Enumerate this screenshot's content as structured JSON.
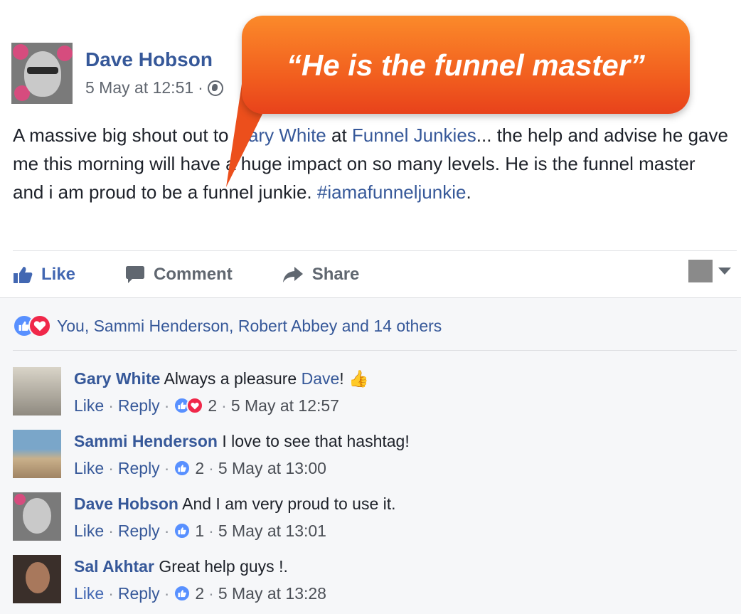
{
  "post": {
    "author": "Dave Hobson",
    "date": "5 May at 12:51",
    "separator": "·",
    "body_prefix": "A massive big shout out to ",
    "mention_person": "Gary White",
    "body_mid": " at ",
    "mention_page": "Funnel Junkies",
    "body_rest": "... the help and advise he gave me this morning will have a huge impact on so many levels. He is the funnel master and i am proud to be a funnel junkie. ",
    "hashtag": "#iamafunneljunkie",
    "body_end": "."
  },
  "actions": {
    "like": "Like",
    "comment": "Comment",
    "share": "Share"
  },
  "reactions_summary": "You, Sammi Henderson, Robert Abbey and 14 others",
  "callout": "“He is the funnel master”",
  "comments": [
    {
      "name": "Gary White",
      "text": "Always a pleasure ",
      "mention": "Dave",
      "text_end": "! 👍",
      "like": "Like",
      "reply": "Reply",
      "count": "2",
      "time": "5 May at 12:57"
    },
    {
      "name": "Sammi Henderson",
      "text": "I love to see that hashtag!",
      "mention": "",
      "text_end": "",
      "like": "Like",
      "reply": "Reply",
      "count": "2",
      "time": "5 May at 13:00"
    },
    {
      "name": "Dave Hobson",
      "text": "And I am very proud to use it.",
      "mention": "",
      "text_end": "",
      "like": "Like",
      "reply": "Reply",
      "count": "1",
      "time": "5 May at 13:01"
    },
    {
      "name": "Sal Akhtar",
      "text": "Great help guys !.",
      "mention": "",
      "text_end": "",
      "like": "Like",
      "reply": "Reply",
      "count": "2",
      "time": "5 May at 13:28"
    }
  ],
  "colors": {
    "link_blue": "#365899",
    "like_blue": "#4267b2",
    "callout_orange": "#f2601f"
  },
  "icons": [
    "thumbs-up-icon",
    "comment-icon",
    "share-arrow-icon",
    "globe-icon",
    "love-reaction-icon",
    "chevron-down-icon"
  ]
}
